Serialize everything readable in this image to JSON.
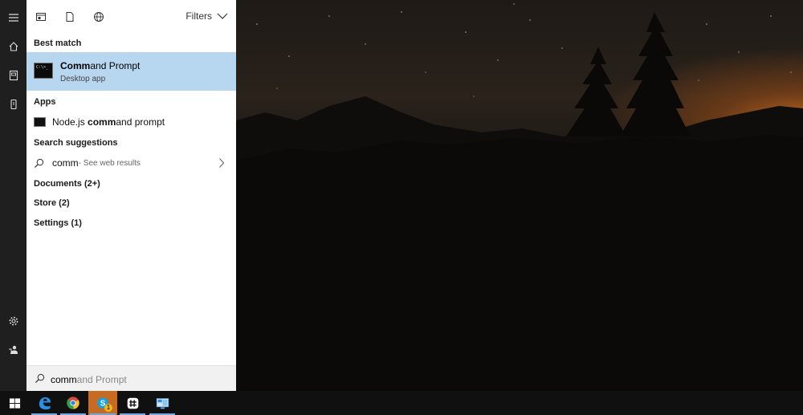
{
  "search_panel": {
    "filters_label": "Filters",
    "best_match_header": "Best match",
    "best_match": {
      "title_bold": "Comm",
      "title_rest": "and Prompt",
      "subtitle": "Desktop app"
    },
    "apps_header": "Apps",
    "apps": [
      {
        "pre": "Node.js ",
        "bold": "comm",
        "post": "and prompt"
      }
    ],
    "suggestions_header": "Search suggestions",
    "suggestion": {
      "query": "comm",
      "hint": " - See web results"
    },
    "categories": [
      "Documents (2+)",
      "Store (2)",
      "Settings (1)"
    ],
    "search_box": {
      "typed": "comm",
      "autocomplete": "and Prompt"
    }
  },
  "colors": {
    "highlight": "#b7d7f1",
    "rail": "#1f1f1f",
    "taskbar": "#101010",
    "skype_active": "#c76b23"
  },
  "taskbar_apps": [
    "windows-start",
    "edge",
    "chrome",
    "skype",
    "slack",
    "remote-desktop"
  ],
  "skype_badge": "1"
}
